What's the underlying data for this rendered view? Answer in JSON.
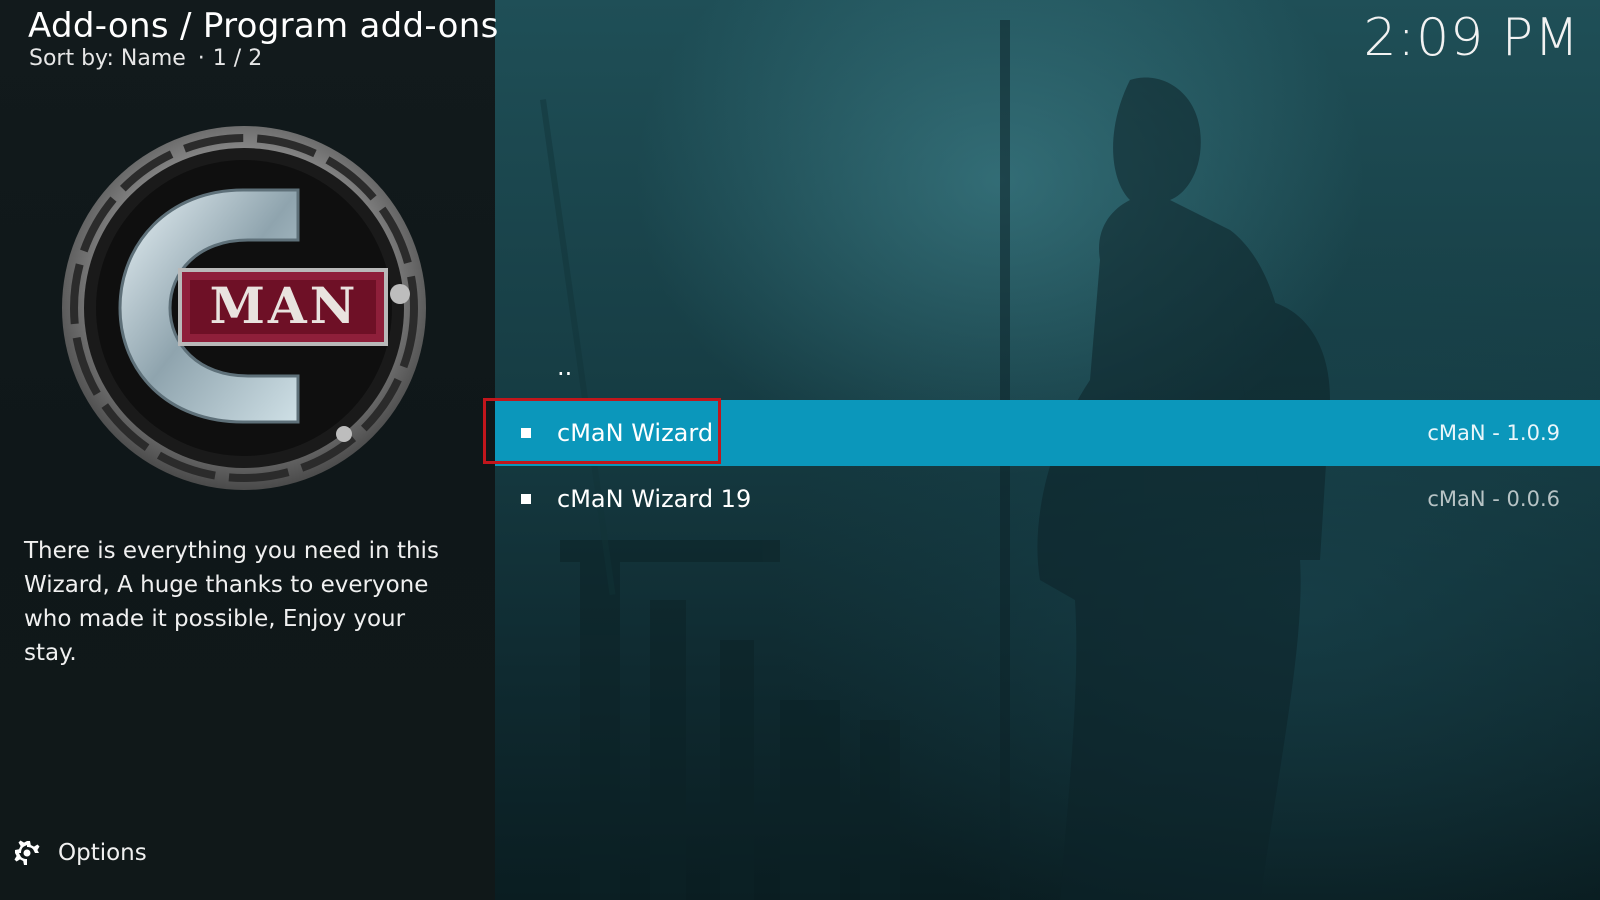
{
  "header": {
    "title": "Add-ons / Program add-ons",
    "sort_label": "Sort by: Name",
    "separator": "·",
    "page_counter": "1 / 2"
  },
  "clock": "2:09 PM",
  "addon": {
    "logo_icon": "cman-logo-icon",
    "logo_text": "MAN",
    "description": "There is everything you need in this Wizard, A huge thanks to everyone who made it possible, Enjoy your stay."
  },
  "list": {
    "parent_label": "..",
    "items": [
      {
        "label": "cMaN Wizard",
        "version": "cMaN - 1.0.9",
        "selected": true
      },
      {
        "label": "cMaN Wizard 19",
        "version": "cMaN - 0.0.6",
        "selected": false
      }
    ]
  },
  "footer": {
    "options_label": "Options",
    "options_icon": "gear-icon"
  },
  "colors": {
    "selection": "#0b97bb",
    "focus_outline": "#c1161c",
    "left_panel": "#121a1c"
  }
}
